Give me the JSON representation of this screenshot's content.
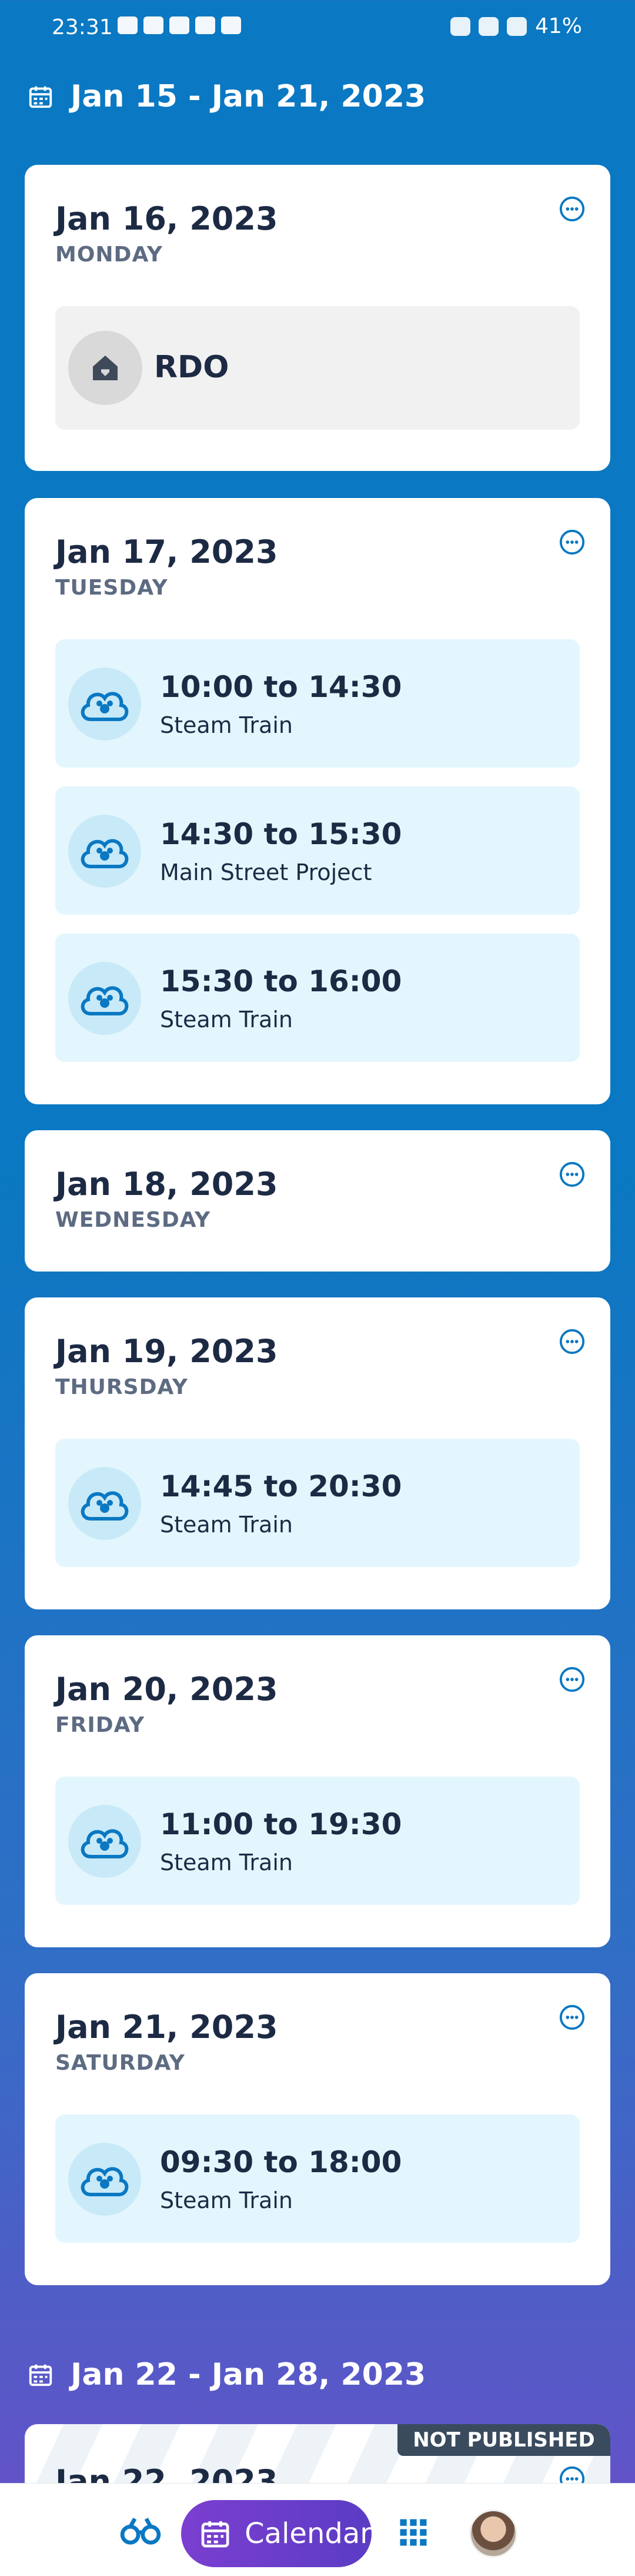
{
  "status_bar": {
    "time": "23:31",
    "battery": "41%"
  },
  "weeks": [
    {
      "range": "Jan 15 - Jan 21, 2023"
    },
    {
      "range": "Jan 22 - Jan 28, 2023",
      "badge": "NOT PUBLISHED"
    }
  ],
  "days": [
    {
      "date": "Jan 16, 2023",
      "weekday": "MONDAY",
      "rdo_label": "RDO"
    },
    {
      "date": "Jan 17, 2023",
      "weekday": "TUESDAY",
      "shifts": [
        {
          "time": "10:00 to 14:30",
          "place": "Steam Train"
        },
        {
          "time": "14:30 to 15:30",
          "place": "Main Street Project"
        },
        {
          "time": "15:30 to 16:00",
          "place": "Steam Train"
        }
      ]
    },
    {
      "date": "Jan 18, 2023",
      "weekday": "WEDNESDAY"
    },
    {
      "date": "Jan 19, 2023",
      "weekday": "THURSDAY",
      "shifts": [
        {
          "time": "14:45 to 20:30",
          "place": "Steam Train"
        }
      ]
    },
    {
      "date": "Jan 20, 2023",
      "weekday": "FRIDAY",
      "shifts": [
        {
          "time": "11:00 to 19:30",
          "place": "Steam Train"
        }
      ]
    },
    {
      "date": "Jan 21, 2023",
      "weekday": "SATURDAY",
      "shifts": [
        {
          "time": "09:30 to 18:00",
          "place": "Steam Train"
        }
      ]
    }
  ],
  "next_week_first_day": "Jan 22, 2023",
  "bottom_nav": {
    "calendar_label": "Calendar"
  },
  "colors": {
    "primary_blue": "#0a78c2",
    "shift_bg": "#e3f6fd",
    "accent_purple": "#7b3fd0",
    "badge_bg": "#3a4b5e"
  }
}
